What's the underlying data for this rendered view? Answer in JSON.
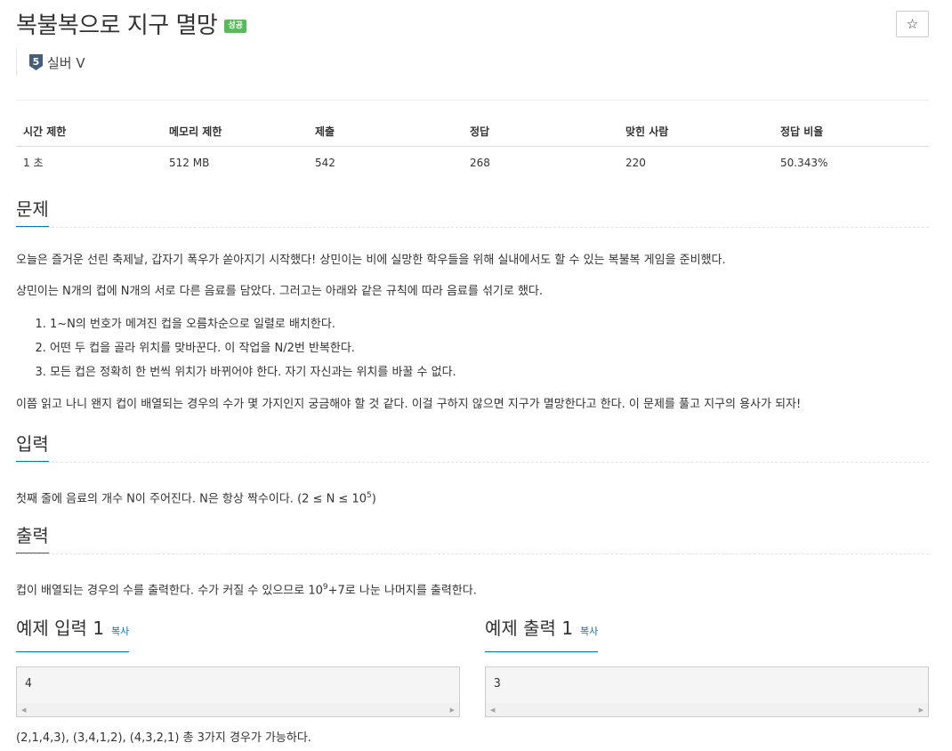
{
  "problem": {
    "title": "복불복으로 지구 멸망",
    "status_badge": "성공",
    "star_icon": "☆",
    "tier": {
      "number": "5",
      "label": "실버 V",
      "color": "#435F7A"
    }
  },
  "info_table": {
    "headers": [
      "시간 제한",
      "메모리 제한",
      "제출",
      "정답",
      "맞힌 사람",
      "정답 비율"
    ],
    "values": [
      "1 초",
      "512 MB",
      "542",
      "268",
      "220",
      "50.343%"
    ]
  },
  "sections": {
    "problem_title": "문제",
    "problem_p1": "오늘은 즐거운 선린 축제날, 갑자기 폭우가 쏟아지기 시작했다! 상민이는 비에 실망한 학우들을 위해 실내에서도 할 수 있는 복불복 게임을 준비했다.",
    "problem_p2": "상민이는 N개의 컵에 N개의 서로 다른 음료를 담았다. 그러고는 아래와 같은 규칙에 따라 음료를 섞기로 했다.",
    "rules": [
      "1~N의 번호가 메겨진 컵을 오름차순으로 일렬로 배치한다.",
      "어떤 두 컵을 골라 위치를 맞바꾼다. 이 작업을 N/2번 반복한다.",
      "모든 컵은 정확히 한 번씩 위치가 바뀌어야 한다. 자기 자신과는 위치를 바꿀 수 없다."
    ],
    "problem_p3": "이쯤 읽고 나니 왠지 컵이 배열되는 경우의 수가 몇 가지인지 궁금해야 할 것 같다. 이걸 구하지 않으면 지구가 멸망한다고 한다. 이 문제를 풀고 지구의 용사가 되자!",
    "input_title": "입력",
    "input_text": "첫째 줄에 음료의 개수 N이 주어진다. N은 항상 짝수이다. (2 ≤ N ≤ 10",
    "input_sup": "5",
    "input_tail": ")",
    "output_title": "출력",
    "output_text": "컵이 배열되는 경우의 수를 출력한다. 수가 커질 수 있으므로 10",
    "output_sup": "9",
    "output_tail": "+7로 나눈 나머지를 출력한다."
  },
  "samples": {
    "input_title": "예제 입력 1",
    "output_title": "예제 출력 1",
    "copy_label": "복사",
    "input_value": "4",
    "output_value": "3",
    "explanation": "(2,1,4,3), (3,4,1,2), (4,3,2,1) 총 3가지 경우가 가능하다."
  },
  "colors": {
    "accent": "#0076C0",
    "success": "#5cb85c"
  }
}
